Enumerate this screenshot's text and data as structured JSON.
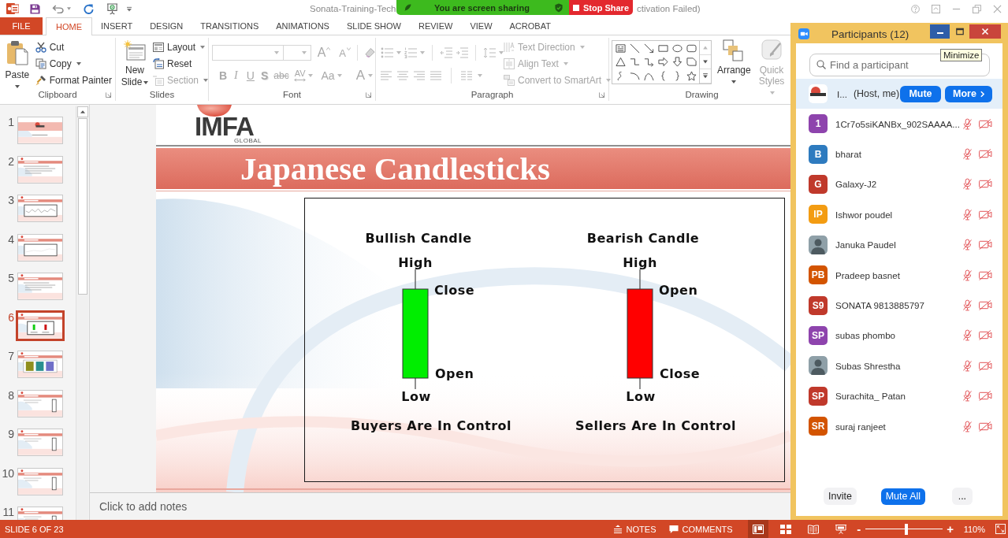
{
  "title_bar": {
    "title": "Sonata-Training-Tech",
    "title_end": "ctivation Failed)"
  },
  "share_banner": {
    "message": "You are screen sharing",
    "stop": "Stop Share"
  },
  "tabs": [
    {
      "label": "FILE",
      "kind": "backstage",
      "selected": false
    },
    {
      "label": "HOME",
      "kind": "tab",
      "selected": true
    },
    {
      "label": "INSERT",
      "kind": "tab",
      "selected": false
    },
    {
      "label": "DESIGN",
      "kind": "tab",
      "selected": false
    },
    {
      "label": "TRANSITIONS",
      "kind": "tab",
      "selected": false
    },
    {
      "label": "ANIMATIONS",
      "kind": "tab",
      "selected": false
    },
    {
      "label": "SLIDE SHOW",
      "kind": "tab",
      "selected": false
    },
    {
      "label": "REVIEW",
      "kind": "tab",
      "selected": false
    },
    {
      "label": "VIEW",
      "kind": "tab",
      "selected": false
    },
    {
      "label": "ACROBAT",
      "kind": "tab",
      "selected": false
    }
  ],
  "ribbon": {
    "clipboard": {
      "label": "Clipboard",
      "paste": "Paste",
      "commands": [
        {
          "label": "Cut",
          "kind": "cut",
          "disabled": false,
          "dropdown": false
        },
        {
          "label": "Copy",
          "kind": "copy",
          "disabled": false,
          "dropdown": true
        },
        {
          "label": "Format Painter",
          "kind": "painter",
          "disabled": false,
          "dropdown": false
        }
      ]
    },
    "slides": {
      "label": "Slides",
      "new_slide": "New Slide",
      "commands": [
        {
          "label": "Layout",
          "kind": "layout",
          "disabled": false,
          "dropdown": true
        },
        {
          "label": "Reset",
          "kind": "reset",
          "disabled": false,
          "dropdown": false
        },
        {
          "label": "Section",
          "kind": "section",
          "disabled": true,
          "dropdown": true
        }
      ]
    },
    "font": {
      "label": "Font",
      "size_buttons": [
        {
          "label": "A",
          "kind": "grow",
          "disabled": true
        },
        {
          "label": "A",
          "kind": "shrink",
          "disabled": true
        }
      ],
      "format_buttons": [
        {
          "label": "B",
          "kind": "bold",
          "disabled": true
        },
        {
          "label": "I",
          "kind": "italic",
          "disabled": true
        },
        {
          "label": "U",
          "kind": "underline",
          "disabled": true
        },
        {
          "label": "S",
          "kind": "shadow",
          "disabled": true
        },
        {
          "label": "abc",
          "kind": "strike",
          "disabled": true
        },
        {
          "label": "AV",
          "kind": "spacing",
          "disabled": true
        },
        {
          "label": "Aa",
          "kind": "case",
          "disabled": true
        },
        {
          "label": "A",
          "kind": "color",
          "disabled": true
        }
      ]
    },
    "paragraph": {
      "label": "Paragraph",
      "commands": [
        {
          "label": "Text Direction",
          "kind": "direction",
          "disabled": true,
          "dropdown": true
        },
        {
          "label": "Align Text",
          "kind": "align",
          "disabled": true,
          "dropdown": true
        },
        {
          "label": "Convert to SmartArt",
          "kind": "smartart",
          "disabled": true,
          "dropdown": true
        }
      ]
    },
    "drawing": {
      "label": "Drawing",
      "commands": [
        {
          "label": "Arrange",
          "kind": "arrange",
          "disabled": false
        },
        {
          "label": "Quick Styles",
          "kind": "styles",
          "disabled": true
        }
      ]
    }
  },
  "slides": [
    {
      "number": "1",
      "kind": "title",
      "selected": false
    },
    {
      "number": "2",
      "kind": "bullets",
      "selected": false
    },
    {
      "number": "3",
      "kind": "line-chart",
      "selected": false
    },
    {
      "number": "4",
      "kind": "frame-chart",
      "selected": false
    },
    {
      "number": "5",
      "kind": "bullets",
      "selected": false
    },
    {
      "number": "6",
      "kind": "candles",
      "selected": true
    },
    {
      "number": "7",
      "kind": "cards",
      "selected": false
    },
    {
      "number": "8",
      "kind": "column",
      "selected": false
    },
    {
      "number": "9",
      "kind": "column",
      "selected": false
    },
    {
      "number": "10",
      "kind": "column",
      "selected": false
    },
    {
      "number": "11",
      "kind": "column",
      "selected": false
    }
  ],
  "slide": {
    "logo": "IMFA",
    "logo_tagline": "GLOBAL",
    "title": "Japanese Candlesticks",
    "candles": [
      {
        "heading": "Bullish Candle",
        "high": "High",
        "upper_label": "Close",
        "lower_label": "Open",
        "low": "Low",
        "caption": "Buyers Are In Control",
        "color": "#00ee00"
      },
      {
        "heading": "Bearish Candle",
        "high": "High",
        "upper_label": "Open",
        "lower_label": "Close",
        "low": "Low",
        "caption": "Sellers Are In Control",
        "color": "#ff0000"
      }
    ]
  },
  "notes": {
    "placeholder": "Click to add notes"
  },
  "status_bar": {
    "slide_info": "SLIDE 6 OF 23",
    "notes": "NOTES",
    "comments": "COMMENTS",
    "views": [
      {
        "kind": "normal",
        "selected": true
      },
      {
        "kind": "sorter",
        "selected": false
      },
      {
        "kind": "reading",
        "selected": false
      },
      {
        "kind": "slideshow",
        "selected": false
      }
    ],
    "zoom_out": "-",
    "zoom_in": "+",
    "zoom_slider": {
      "level": 0.53
    },
    "zoom": "110%"
  },
  "participants": {
    "title": "Participants (12)",
    "tooltip": "Minimize",
    "search_placeholder": "Find a participant",
    "host": {
      "name": "I...",
      "role": "(Host, me)",
      "mute": "Mute",
      "more": "More",
      "highlighted": true
    },
    "list": [
      {
        "name": "1Cr7o5siKANBx_902SAAAA...",
        "kind": "initials",
        "initials": "1",
        "color": "#8e44ad",
        "muted": true,
        "video_off": true
      },
      {
        "name": "bharat",
        "kind": "initials",
        "initials": "B",
        "color": "#2e7bbf",
        "muted": true,
        "video_off": true
      },
      {
        "name": "Galaxy-J2",
        "kind": "initials",
        "initials": "G",
        "color": "#c0392b",
        "muted": true,
        "video_off": true
      },
      {
        "name": "Ishwor poudel",
        "kind": "initials",
        "initials": "IP",
        "color": "#f39c12",
        "muted": true,
        "video_off": true
      },
      {
        "name": "Januka Paudel",
        "kind": "photo",
        "muted": true,
        "video_off": true
      },
      {
        "name": "Pradeep basnet",
        "kind": "initials",
        "initials": "PB",
        "color": "#d35400",
        "muted": true,
        "video_off": true
      },
      {
        "name": "SONATA 9813885797",
        "kind": "initials",
        "initials": "S9",
        "color": "#c0392b",
        "muted": true,
        "video_off": true
      },
      {
        "name": "subas phombo",
        "kind": "initials",
        "initials": "SP",
        "color": "#8e44ad",
        "muted": true,
        "video_off": true
      },
      {
        "name": "Subas Shrestha",
        "kind": "photo",
        "muted": true,
        "video_off": true
      },
      {
        "name": "Surachita_ Patan",
        "kind": "initials",
        "initials": "SP",
        "color": "#c0392b",
        "muted": true,
        "video_off": true
      },
      {
        "name": "suraj ranjeet",
        "kind": "initials",
        "initials": "SR",
        "color": "#d35400",
        "muted": true,
        "video_off": true
      }
    ],
    "footer": {
      "invite": "Invite",
      "mute_all": "Mute All",
      "more": "..."
    }
  }
}
